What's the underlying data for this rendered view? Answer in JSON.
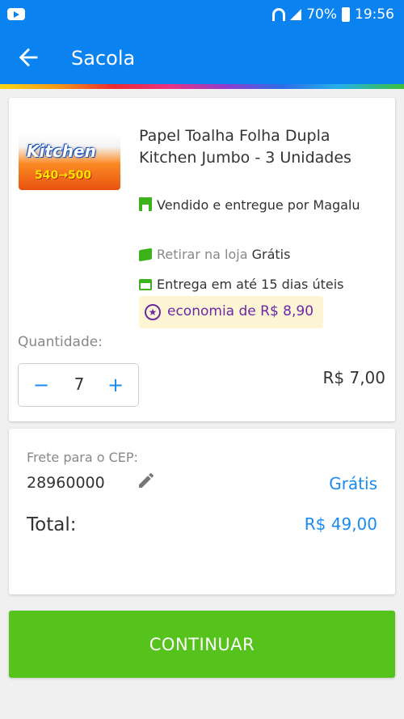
{
  "status_bar": {
    "battery": "70%",
    "time": "19:56"
  },
  "header": {
    "title": "Sacola"
  },
  "product": {
    "image_brand": "Kitchen",
    "image_promo": "540→500",
    "name": "Papel Toalha Folha Dupla Kitchen Jumbo - 3 Unidades",
    "seller": "Vendido e entregue por Magalu",
    "pickup_label": "Retirar na loja",
    "pickup_price": "Grátis",
    "delivery": "Entrega em até 15 dias úteis",
    "economy": "economia de R$ 8,90"
  },
  "quantity": {
    "label": "Quantidade:",
    "value": "7",
    "minus": "−",
    "plus": "+"
  },
  "unit_price": "R$ 7,00",
  "freight": {
    "cep_label": "Frete para o CEP:",
    "cep": "28960000",
    "price": "Grátis",
    "total_label": "Total:",
    "total": "R$ 49,00"
  },
  "actions": {
    "continue": "CONTINUAR"
  },
  "colors": {
    "primary": "#0a83f0",
    "accent_green": "#56c21c",
    "link_blue": "#1a8af0",
    "economy_purple": "#6c28a6"
  },
  "icons": [
    "youtube-icon",
    "wifi-icon",
    "signal-icon",
    "battery-icon",
    "back-arrow-icon",
    "store-icon",
    "box-icon",
    "calendar-icon",
    "star-icon",
    "edit-icon"
  ]
}
